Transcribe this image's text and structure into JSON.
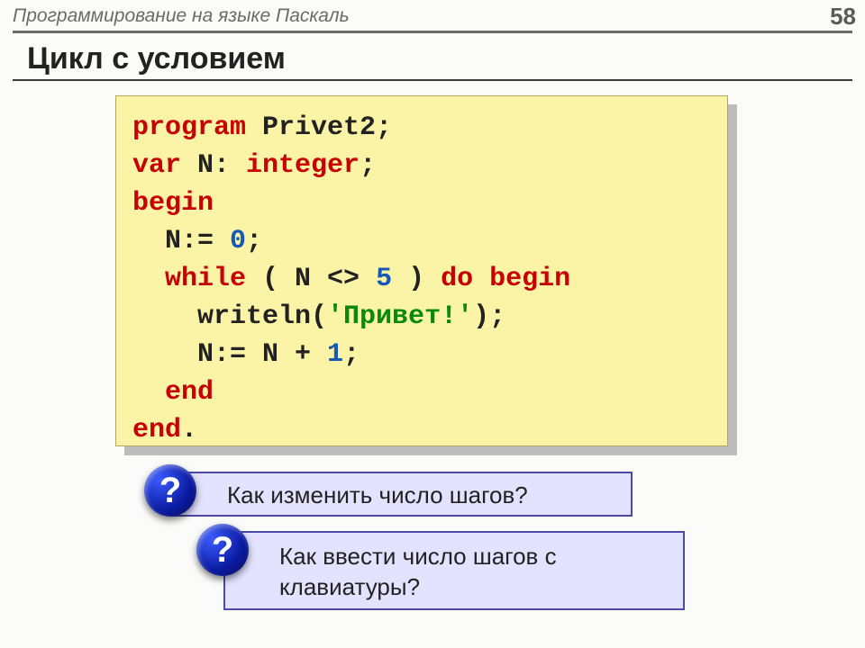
{
  "header": {
    "course": "Программирование на языке Паскаль",
    "page": "58"
  },
  "title": "Цикл с условием",
  "code": {
    "l1_kw": "program",
    "l1_id": " Privet2;",
    "l2_kw": "var",
    "l2_a": " N: ",
    "l2_type": "integer",
    "l2_b": ";",
    "l3": "begin",
    "l4_a": "  N:= ",
    "l4_num": "0",
    "l4_b": ";",
    "l5_a": "  ",
    "l5_while": "while",
    "l5_b": " ( N <> ",
    "l5_num": "5",
    "l5_c": " ) ",
    "l5_do": "do begin",
    "l6_a": "    writeln(",
    "l6_str": "'Привет!'",
    "l6_b": ");",
    "l7_a": "    N:= N + ",
    "l7_num": "1",
    "l7_b": ";",
    "l8": "  end",
    "l9_a": "end",
    "l9_b": "."
  },
  "q1": {
    "icon": "?",
    "text": "Как изменить число шагов?"
  },
  "q2": {
    "icon": "?",
    "text": "Как ввести число шагов с клавиатуры?"
  }
}
